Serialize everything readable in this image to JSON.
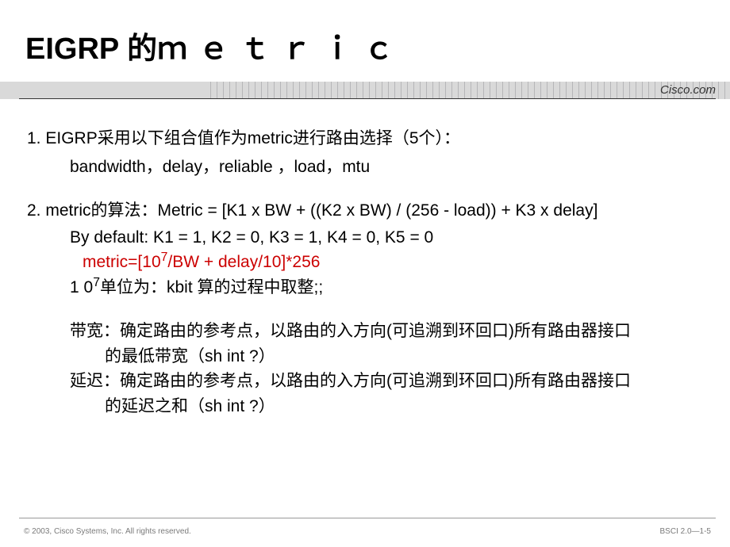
{
  "title_part1": "EIGRP 的",
  "title_part2": "ｍｅｔｒｉｃ",
  "brand": "Cisco.com",
  "p1_line1": "1. EIGRP采用以下组合值作为metric进行路由选择（5个）：",
  "p1_line2": "bandwidth，delay，reliable ，load，mtu",
  "p2_line1": "2. metric的算法：Metric = [K1 x BW + ((K2 x BW) / (256 - load)) + K3 x delay]",
  "p2_line2": "By default: K1 = 1, K2 = 0, K3 = 1, K4 = 0, K5 = 0",
  "p2_line3a": "metric=[10",
  "p2_line3sup": "7",
  "p2_line3b": "/BW + delay/10]*256",
  "p2_line4a": "1 0",
  "p2_line4sup": "7",
  "p2_line4b": "单位为：kbit   算的过程中取整;;",
  "p3_l1": "带宽：确定路由的参考点，以路由的入方向(可追溯到环回口)所有路由器接口",
  "p3_l2": "的最低带宽（sh int ?）",
  "p4_l1": "延迟：确定路由的参考点，以路由的入方向(可追溯到环回口)所有路由器接口",
  "p4_l2": "的延迟之和（sh int ?）",
  "copyright": "© 2003, Cisco Systems, Inc. All rights reserved.",
  "pagecode": "BSCI 2.0—1-5"
}
